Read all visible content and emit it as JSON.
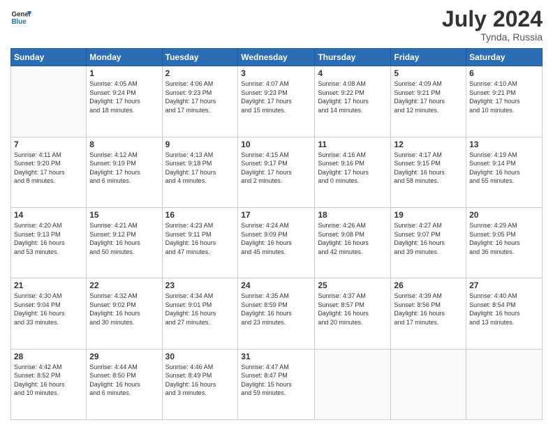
{
  "logo": {
    "line1": "General",
    "line2": "Blue"
  },
  "title": "July 2024",
  "subtitle": "Tynda, Russia",
  "days_of_week": [
    "Sunday",
    "Monday",
    "Tuesday",
    "Wednesday",
    "Thursday",
    "Friday",
    "Saturday"
  ],
  "weeks": [
    [
      {
        "day": "",
        "info": ""
      },
      {
        "day": "1",
        "info": "Sunrise: 4:05 AM\nSunset: 9:24 PM\nDaylight: 17 hours\nand 18 minutes."
      },
      {
        "day": "2",
        "info": "Sunrise: 4:06 AM\nSunset: 9:23 PM\nDaylight: 17 hours\nand 17 minutes."
      },
      {
        "day": "3",
        "info": "Sunrise: 4:07 AM\nSunset: 9:23 PM\nDaylight: 17 hours\nand 15 minutes."
      },
      {
        "day": "4",
        "info": "Sunrise: 4:08 AM\nSunset: 9:22 PM\nDaylight: 17 hours\nand 14 minutes."
      },
      {
        "day": "5",
        "info": "Sunrise: 4:09 AM\nSunset: 9:21 PM\nDaylight: 17 hours\nand 12 minutes."
      },
      {
        "day": "6",
        "info": "Sunrise: 4:10 AM\nSunset: 9:21 PM\nDaylight: 17 hours\nand 10 minutes."
      }
    ],
    [
      {
        "day": "7",
        "info": "Sunrise: 4:11 AM\nSunset: 9:20 PM\nDaylight: 17 hours\nand 8 minutes."
      },
      {
        "day": "8",
        "info": "Sunrise: 4:12 AM\nSunset: 9:19 PM\nDaylight: 17 hours\nand 6 minutes."
      },
      {
        "day": "9",
        "info": "Sunrise: 4:13 AM\nSunset: 9:18 PM\nDaylight: 17 hours\nand 4 minutes."
      },
      {
        "day": "10",
        "info": "Sunrise: 4:15 AM\nSunset: 9:17 PM\nDaylight: 17 hours\nand 2 minutes."
      },
      {
        "day": "11",
        "info": "Sunrise: 4:16 AM\nSunset: 9:16 PM\nDaylight: 17 hours\nand 0 minutes."
      },
      {
        "day": "12",
        "info": "Sunrise: 4:17 AM\nSunset: 9:15 PM\nDaylight: 16 hours\nand 58 minutes."
      },
      {
        "day": "13",
        "info": "Sunrise: 4:19 AM\nSunset: 9:14 PM\nDaylight: 16 hours\nand 55 minutes."
      }
    ],
    [
      {
        "day": "14",
        "info": "Sunrise: 4:20 AM\nSunset: 9:13 PM\nDaylight: 16 hours\nand 53 minutes."
      },
      {
        "day": "15",
        "info": "Sunrise: 4:21 AM\nSunset: 9:12 PM\nDaylight: 16 hours\nand 50 minutes."
      },
      {
        "day": "16",
        "info": "Sunrise: 4:23 AM\nSunset: 9:11 PM\nDaylight: 16 hours\nand 47 minutes."
      },
      {
        "day": "17",
        "info": "Sunrise: 4:24 AM\nSunset: 9:09 PM\nDaylight: 16 hours\nand 45 minutes."
      },
      {
        "day": "18",
        "info": "Sunrise: 4:26 AM\nSunset: 9:08 PM\nDaylight: 16 hours\nand 42 minutes."
      },
      {
        "day": "19",
        "info": "Sunrise: 4:27 AM\nSunset: 9:07 PM\nDaylight: 16 hours\nand 39 minutes."
      },
      {
        "day": "20",
        "info": "Sunrise: 4:29 AM\nSunset: 9:05 PM\nDaylight: 16 hours\nand 36 minutes."
      }
    ],
    [
      {
        "day": "21",
        "info": "Sunrise: 4:30 AM\nSunset: 9:04 PM\nDaylight: 16 hours\nand 33 minutes."
      },
      {
        "day": "22",
        "info": "Sunrise: 4:32 AM\nSunset: 9:02 PM\nDaylight: 16 hours\nand 30 minutes."
      },
      {
        "day": "23",
        "info": "Sunrise: 4:34 AM\nSunset: 9:01 PM\nDaylight: 16 hours\nand 27 minutes."
      },
      {
        "day": "24",
        "info": "Sunrise: 4:35 AM\nSunset: 8:59 PM\nDaylight: 16 hours\nand 23 minutes."
      },
      {
        "day": "25",
        "info": "Sunrise: 4:37 AM\nSunset: 8:57 PM\nDaylight: 16 hours\nand 20 minutes."
      },
      {
        "day": "26",
        "info": "Sunrise: 4:39 AM\nSunset: 8:56 PM\nDaylight: 16 hours\nand 17 minutes."
      },
      {
        "day": "27",
        "info": "Sunrise: 4:40 AM\nSunset: 8:54 PM\nDaylight: 16 hours\nand 13 minutes."
      }
    ],
    [
      {
        "day": "28",
        "info": "Sunrise: 4:42 AM\nSunset: 8:52 PM\nDaylight: 16 hours\nand 10 minutes."
      },
      {
        "day": "29",
        "info": "Sunrise: 4:44 AM\nSunset: 8:50 PM\nDaylight: 16 hours\nand 6 minutes."
      },
      {
        "day": "30",
        "info": "Sunrise: 4:46 AM\nSunset: 8:49 PM\nDaylight: 16 hours\nand 3 minutes."
      },
      {
        "day": "31",
        "info": "Sunrise: 4:47 AM\nSunset: 8:47 PM\nDaylight: 15 hours\nand 59 minutes."
      },
      {
        "day": "",
        "info": ""
      },
      {
        "day": "",
        "info": ""
      },
      {
        "day": "",
        "info": ""
      }
    ]
  ]
}
